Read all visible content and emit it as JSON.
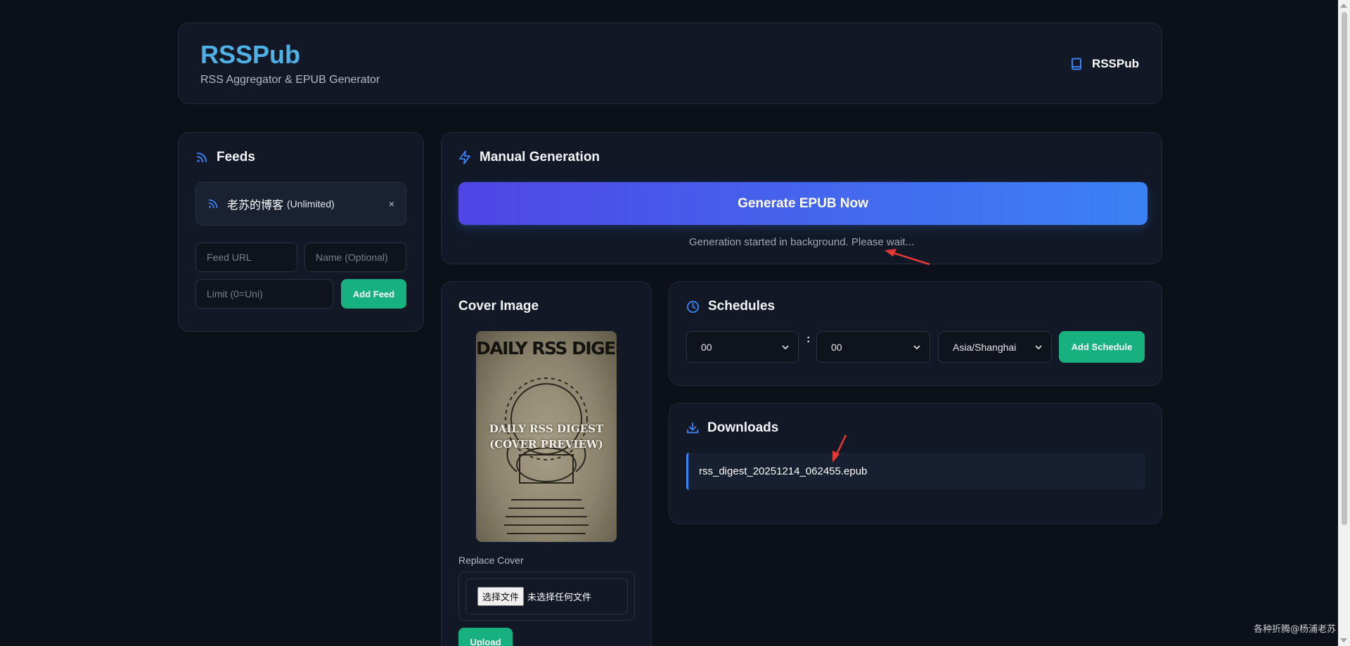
{
  "header": {
    "title": "RSSPub",
    "subtitle": "RSS Aggregator & EPUB Generator",
    "right_label": "RSSPub",
    "right_icon": "book-icon"
  },
  "feeds": {
    "title": "Feeds",
    "icon": "rss-icon",
    "items": [
      {
        "name": "老苏的博客",
        "limit": "(Unlimited)",
        "remove": "×"
      }
    ],
    "url_placeholder": "Feed URL",
    "name_placeholder": "Name (Optional)",
    "limit_placeholder": "Limit (0=Uni)",
    "add_label": "Add Feed"
  },
  "manual": {
    "title": "Manual Generation",
    "icon": "lightning-icon",
    "button_label": "Generate EPUB Now",
    "status": "Generation started in background. Please wait..."
  },
  "cover": {
    "title": "Cover Image",
    "image_text_top": "DAILY RSS DIGEST",
    "image_text_mid1": "DAILY RSS DIGEST",
    "image_text_mid2": "(COVER PREVIEW)",
    "replace_label": "Replace Cover",
    "file_button": "选择文件",
    "file_status": "未选择任何文件",
    "upload_label": "Upload"
  },
  "schedules": {
    "title": "Schedules",
    "icon": "clock-icon",
    "hour": "00",
    "minute": "00",
    "colon": ":",
    "timezone": "Asia/Shanghai",
    "add_label": "Add Schedule"
  },
  "downloads": {
    "title": "Downloads",
    "icon": "download-icon",
    "items": [
      "rss_digest_20251214_062455.epub"
    ]
  },
  "watermark": "各种折腾@杨浦老苏",
  "colors": {
    "accent_blue": "#3b82f6",
    "accent_green": "#16b17f",
    "brand": "#4fb0e6",
    "annotation_red": "#e53935"
  }
}
